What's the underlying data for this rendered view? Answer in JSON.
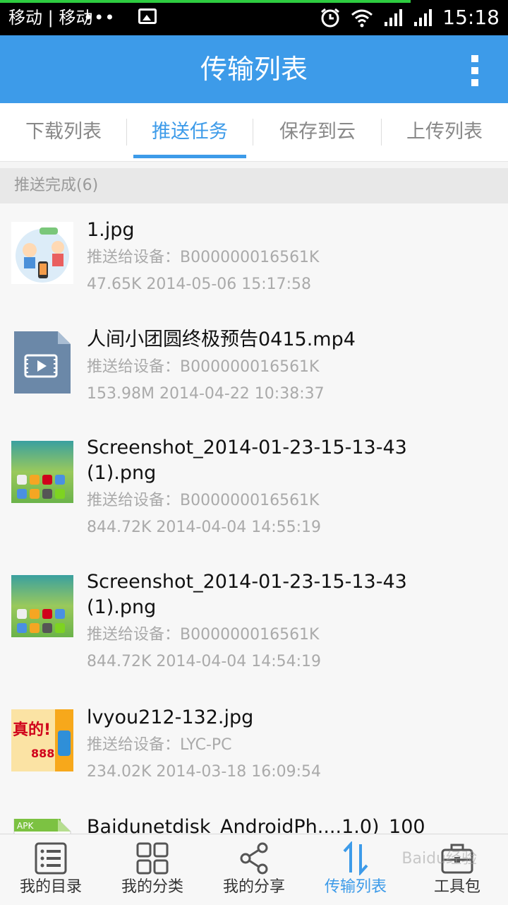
{
  "status_bar": {
    "carrier": "移动 | 移动",
    "dots": "•••",
    "time": "15:18"
  },
  "header": {
    "title": "传输列表"
  },
  "tabs": [
    {
      "label": "下载列表",
      "active": false
    },
    {
      "label": "推送任务",
      "active": true
    },
    {
      "label": "保存到云",
      "active": false
    },
    {
      "label": "上传列表",
      "active": false
    }
  ],
  "section": {
    "title": "推送完成(6)"
  },
  "items": [
    {
      "name": "1.jpg",
      "device": "推送给设备：B000000016561K",
      "info": "47.65K 2014-05-06  15:17:58",
      "thumb": "image-thumb"
    },
    {
      "name": "人间小团圆终极预告0415.mp4",
      "device": "推送给设备：B000000016561K",
      "info": "153.98M 2014-04-22  10:38:37",
      "thumb": "video-file-icon"
    },
    {
      "name": "Screenshot_2014-01-23-15-13-43",
      "name2": "(1).png",
      "device": "推送给设备：B000000016561K",
      "info": "844.72K 2014-04-04  14:55:19",
      "thumb": "screenshot-thumb"
    },
    {
      "name": "Screenshot_2014-01-23-15-13-43",
      "name2": "(1).png",
      "device": "推送给设备：B000000016561K",
      "info": "844.72K 2014-04-04  14:54:19",
      "thumb": "screenshot-thumb"
    },
    {
      "name": "lvyou212-132.jpg",
      "device": "推送给设备：LYC-PC",
      "info": "234.02K 2014-03-18  16:09:54",
      "thumb": "image-thumb",
      "thumb_text": "真的!",
      "thumb_text2": "888"
    },
    {
      "name": "Baidunetdisk_AndroidPh....1.0)_100",
      "thumb": "apk-file-icon",
      "thumb_label": "APK"
    }
  ],
  "bottom_nav": [
    {
      "label": "我的目录",
      "icon": "list-icon"
    },
    {
      "label": "我的分类",
      "icon": "grid-icon"
    },
    {
      "label": "我的分享",
      "icon": "share-icon"
    },
    {
      "label": "传输列表",
      "icon": "transfer-icon",
      "active": true
    },
    {
      "label": "工具包",
      "icon": "toolbox-icon"
    }
  ],
  "watermark": "Baidu经验",
  "colors": {
    "accent": "#3d9be9",
    "status_bar": "#000000"
  }
}
